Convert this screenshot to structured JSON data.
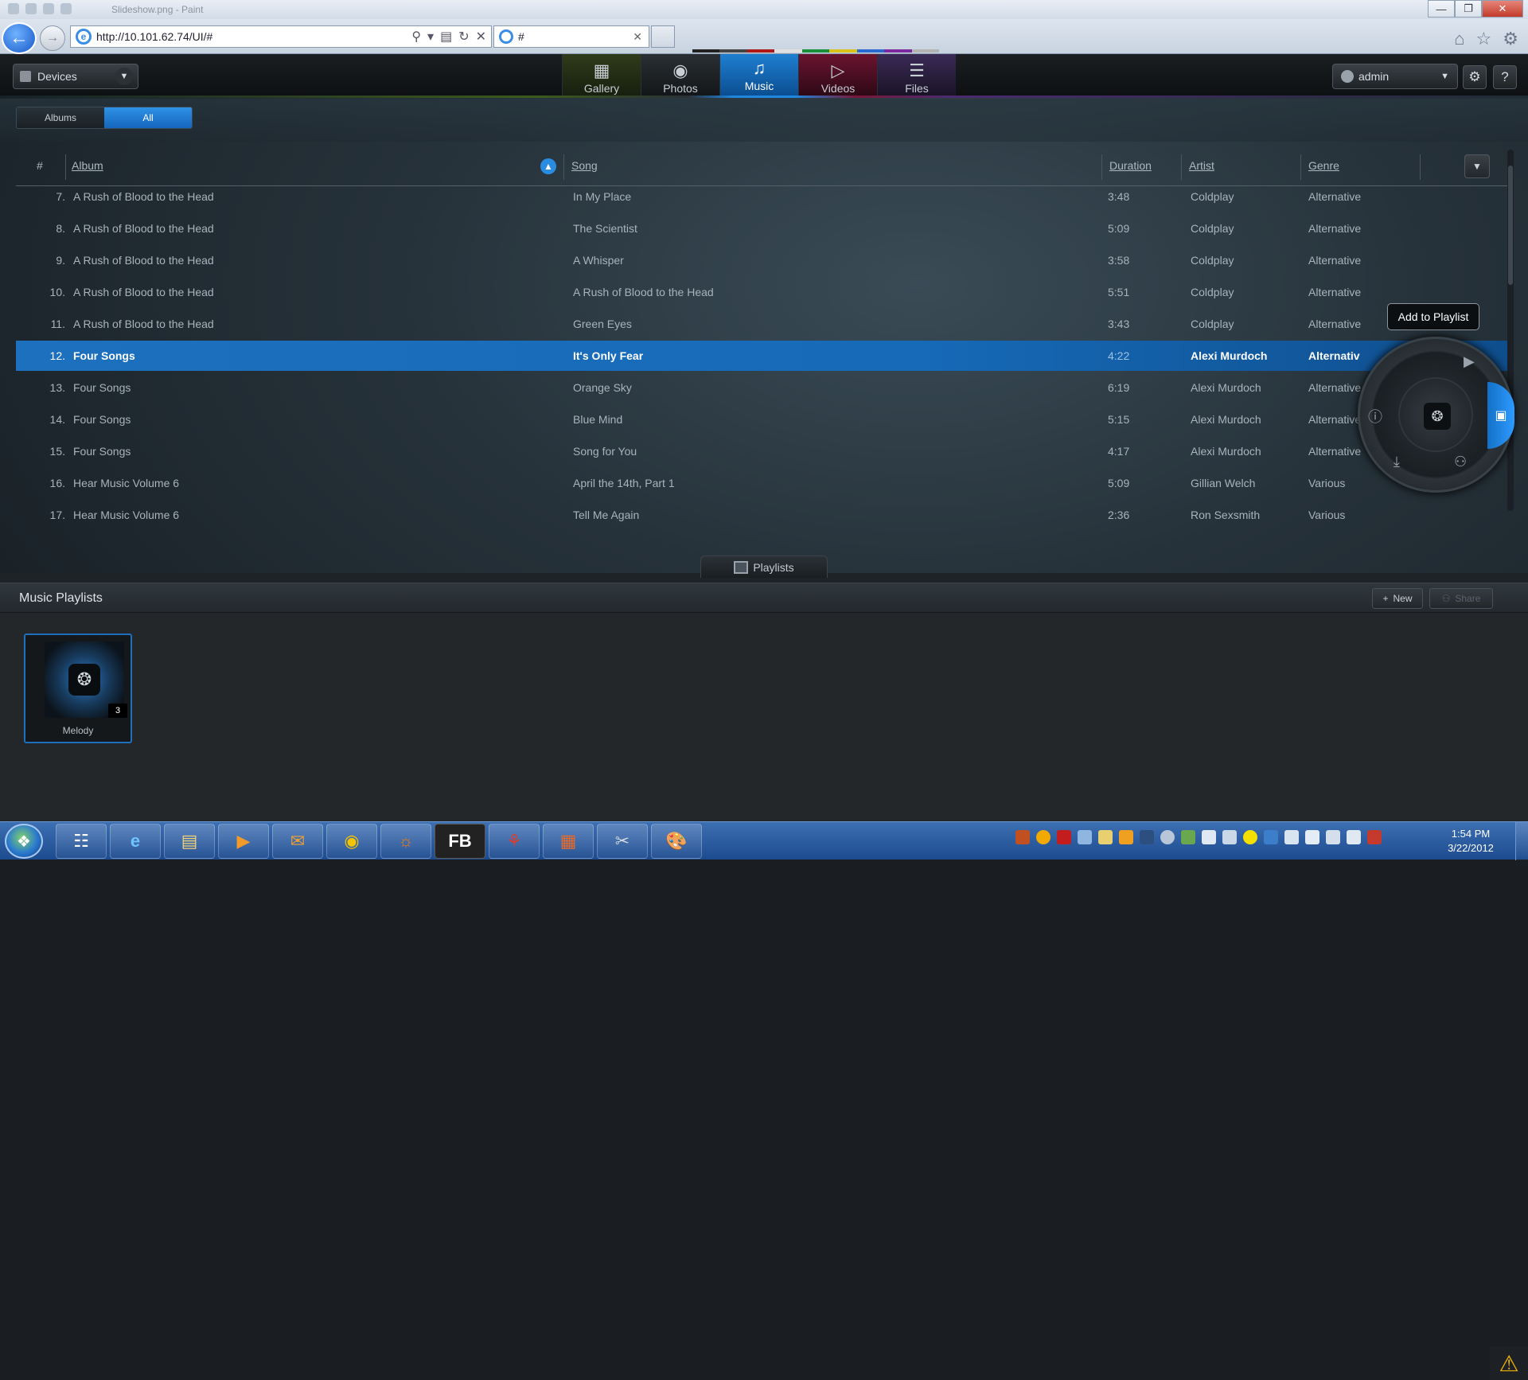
{
  "window": {
    "title": "Slideshow.png - Paint"
  },
  "browser": {
    "url": "http://10.101.62.74/UI/#",
    "tab_title": "#"
  },
  "app": {
    "devices_label": "Devices",
    "tabs": [
      {
        "label": "Gallery"
      },
      {
        "label": "Photos"
      },
      {
        "label": "Music"
      },
      {
        "label": "Videos"
      },
      {
        "label": "Files"
      }
    ],
    "active_tab": "Music",
    "user_label": "admin",
    "view_toggle": {
      "albums": "Albums",
      "all": "All",
      "selected": "All"
    }
  },
  "table": {
    "headers": {
      "num": "#",
      "album": "Album",
      "song": "Song",
      "duration": "Duration",
      "artist": "Artist",
      "genre": "Genre"
    },
    "rows": [
      {
        "n": "7.",
        "album": "A Rush of Blood to the Head",
        "song": "In My Place",
        "duration": "3:48",
        "artist": "Coldplay",
        "genre": "Alternative"
      },
      {
        "n": "8.",
        "album": "A Rush of Blood to the Head",
        "song": "The Scientist",
        "duration": "5:09",
        "artist": "Coldplay",
        "genre": "Alternative"
      },
      {
        "n": "9.",
        "album": "A Rush of Blood to the Head",
        "song": "A Whisper",
        "duration": "3:58",
        "artist": "Coldplay",
        "genre": "Alternative"
      },
      {
        "n": "10.",
        "album": "A Rush of Blood to the Head",
        "song": "A Rush of Blood to the Head",
        "duration": "5:51",
        "artist": "Coldplay",
        "genre": "Alternative"
      },
      {
        "n": "11.",
        "album": "A Rush of Blood to the Head",
        "song": "Green Eyes",
        "duration": "3:43",
        "artist": "Coldplay",
        "genre": "Alternative"
      },
      {
        "n": "12.",
        "album": "Four Songs",
        "song": "It's Only Fear",
        "duration": "4:22",
        "artist": "Alexi Murdoch",
        "genre": "Alternativ"
      },
      {
        "n": "13.",
        "album": "Four Songs",
        "song": "Orange Sky",
        "duration": "6:19",
        "artist": "Alexi Murdoch",
        "genre": "Alternative"
      },
      {
        "n": "14.",
        "album": "Four Songs",
        "song": "Blue Mind",
        "duration": "5:15",
        "artist": "Alexi Murdoch",
        "genre": "Alternative"
      },
      {
        "n": "15.",
        "album": "Four Songs",
        "song": "Song for You",
        "duration": "4:17",
        "artist": "Alexi Murdoch",
        "genre": "Alternative"
      },
      {
        "n": "16.",
        "album": "Hear Music Volume 6",
        "song": "April the 14th, Part 1",
        "duration": "5:09",
        "artist": "Gillian Welch",
        "genre": "Various"
      },
      {
        "n": "17.",
        "album": "Hear Music Volume 6",
        "song": "Tell Me Again",
        "duration": "2:36",
        "artist": "Ron Sexsmith",
        "genre": "Various"
      }
    ],
    "selected_row": "12."
  },
  "context_menu": {
    "tooltip": "Add to Playlist"
  },
  "playlists": {
    "tab_label": "Playlists",
    "title": "Music Playlists",
    "new_label": "New",
    "share_label": "Share",
    "items": [
      {
        "name": "Melody",
        "count": "3"
      }
    ]
  },
  "taskbar": {
    "time": "1:54 PM",
    "date": "3/22/2012",
    "fb_label": "FB"
  },
  "colors": {
    "accent": "#1e80d8",
    "selected_row": "#1c70bd",
    "warning": "#f0b400"
  },
  "icons": [
    "back-icon",
    "forward-icon",
    "search-icon",
    "refresh-icon",
    "stop-icon",
    "home-icon",
    "star-icon",
    "gear-icon",
    "help-icon",
    "gallery-icon",
    "camera-icon",
    "music-note-icon",
    "video-icon",
    "files-icon",
    "sort-up-icon",
    "chevron-down-icon",
    "play-icon",
    "info-icon",
    "download-icon",
    "share-people-icon",
    "add-playlist-icon",
    "playlist-icon",
    "plus-icon",
    "warning-icon",
    "start-icon"
  ]
}
